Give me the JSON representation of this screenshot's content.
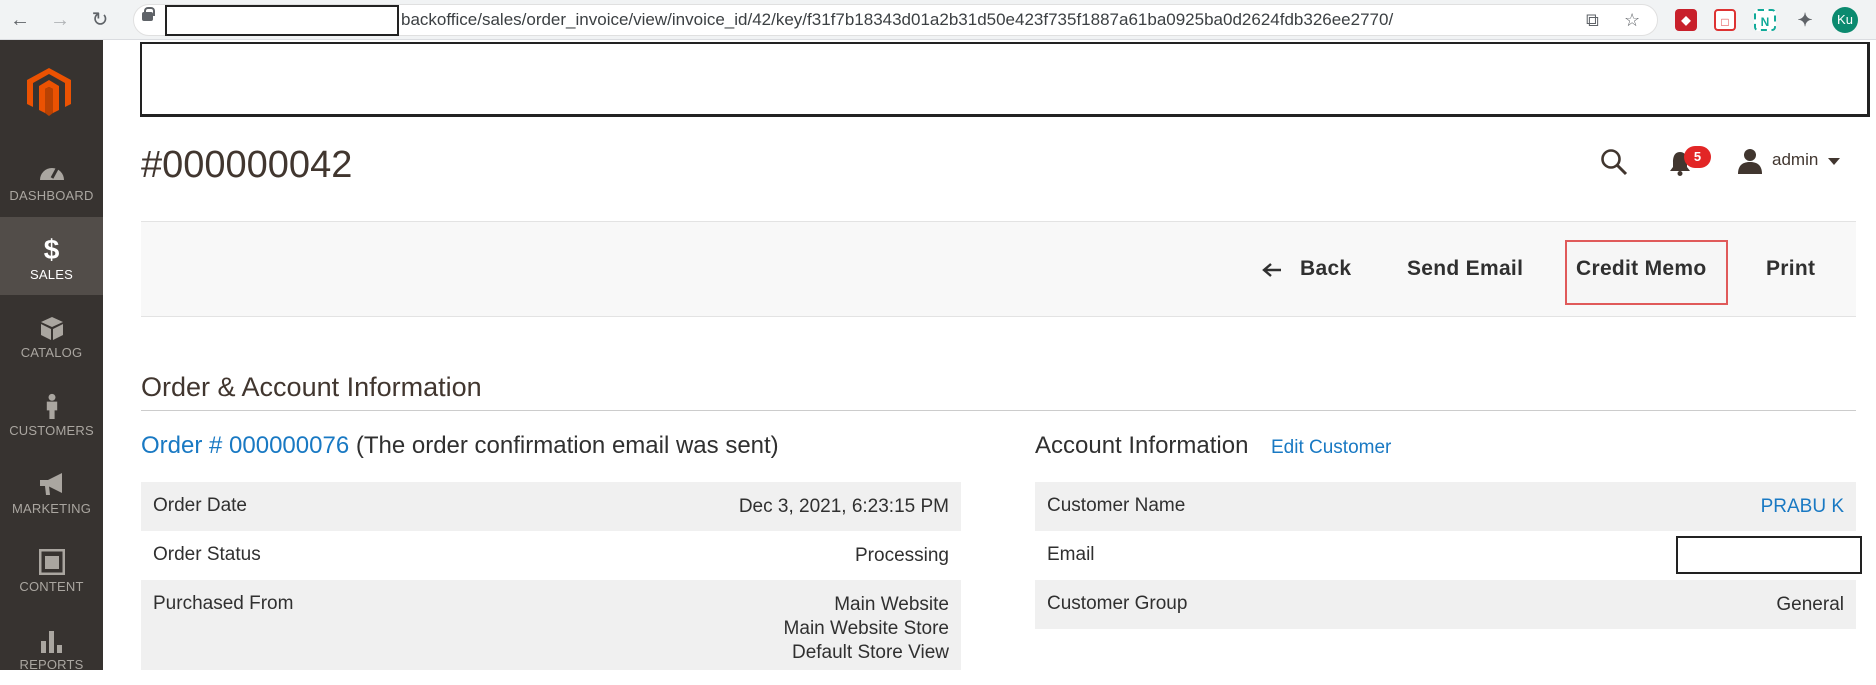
{
  "browser": {
    "url": "backoffice/sales/order_invoice/view/invoice_id/42/key/f31f7b18343d01a2b31d50e423f735f1887a61ba0925ba0d2624fdb326ee2770/",
    "profile_initials": "Ku"
  },
  "sidebar": {
    "items": [
      {
        "label": "DASHBOARD",
        "icon": "dashboard-icon"
      },
      {
        "label": "SALES",
        "icon": "dollar-icon"
      },
      {
        "label": "CATALOG",
        "icon": "box-icon"
      },
      {
        "label": "CUSTOMERS",
        "icon": "person-icon"
      },
      {
        "label": "MARKETING",
        "icon": "megaphone-icon"
      },
      {
        "label": "CONTENT",
        "icon": "layout-icon"
      },
      {
        "label": "REPORTS",
        "icon": "bar-chart-icon"
      }
    ],
    "active": "SALES"
  },
  "header": {
    "title": "#000000042",
    "notification_count": "5",
    "user": "admin"
  },
  "actions": {
    "back": "Back",
    "send_email": "Send Email",
    "credit_memo": "Credit Memo",
    "print": "Print"
  },
  "section": {
    "title": "Order & Account Information"
  },
  "order": {
    "link": "Order # 000000076",
    "note": "(The order confirmation email was sent)",
    "rows": [
      {
        "label": "Order Date",
        "value": "Dec 3, 2021, 6:23:15 PM"
      },
      {
        "label": "Order Status",
        "value": "Processing"
      },
      {
        "label": "Purchased From",
        "value_lines": [
          "Main Website",
          "Main Website Store",
          "Default Store View"
        ]
      }
    ]
  },
  "account": {
    "title": "Account Information",
    "edit_link": "Edit Customer",
    "rows": [
      {
        "label": "Customer Name",
        "value": "PRABU K"
      },
      {
        "label": "Email",
        "value": ""
      },
      {
        "label": "Customer Group",
        "value": "General"
      }
    ]
  }
}
